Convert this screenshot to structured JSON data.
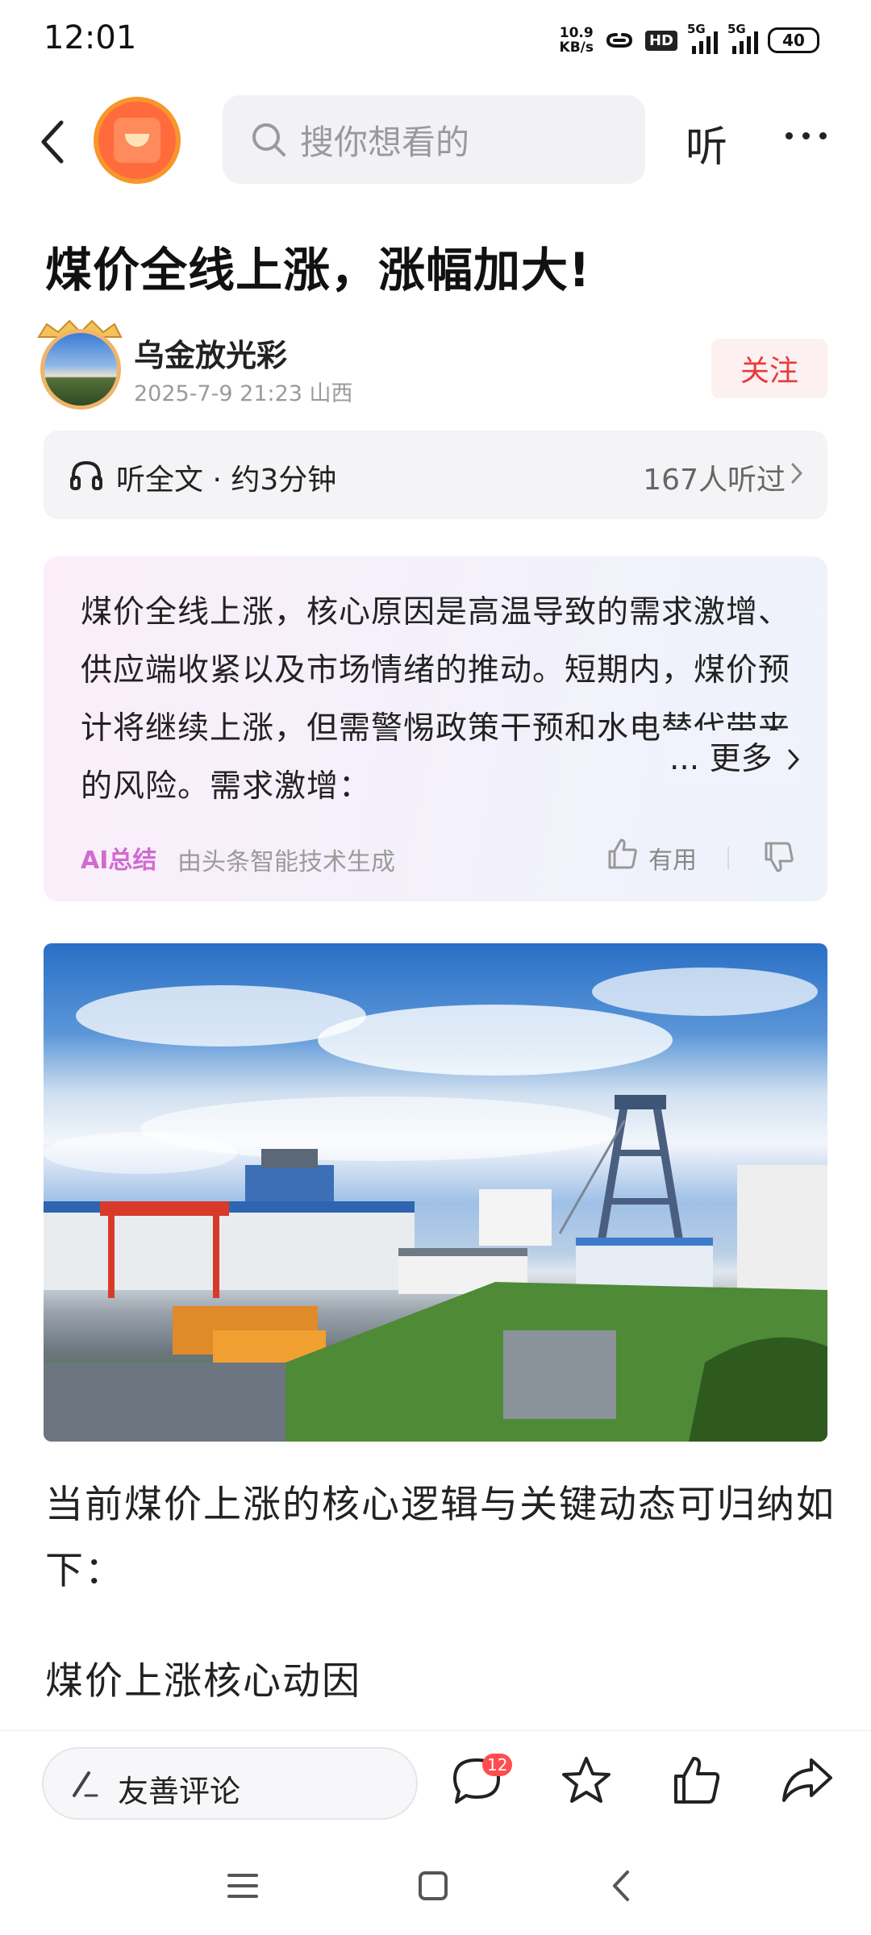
{
  "status_bar": {
    "time": "12:01",
    "net_speed_value": "10.9",
    "net_speed_unit": "KB/s",
    "hd_label": "HD",
    "network_1": "5G",
    "network_2": "5G",
    "battery": "40"
  },
  "nav": {
    "search_placeholder": "搜你想看的",
    "listen_label": "听"
  },
  "article": {
    "title": "煤价全线上涨，涨幅加大!",
    "author_name": "乌金放光彩",
    "author_meta": "2025-7-9  21:23  山西",
    "follow_label": "关注"
  },
  "listen_bar": {
    "label": "听全文 · 约3分钟",
    "count": "167人听过"
  },
  "ai_summary": {
    "text": "煤价全线上涨，核心原因是高温导致的需求激增、供应端收紧以及市场情绪的推动。短期内，煤价预计将继续上涨，但需警惕政策干预和水电替代带来的风险。需求激增：",
    "more_label": "... 更多",
    "badge": "AI总结",
    "source": "由头条智能技术生成",
    "useful_label": "有用"
  },
  "body": {
    "paragraph_1": "当前煤价上涨的核心逻辑与关键动态可归纳如下：",
    "heading_1": "煤价上涨核心动因"
  },
  "bottom_bar": {
    "comment_placeholder": "友善评论",
    "comment_count": "12"
  },
  "colors": {
    "accent_red": "#e83a3a",
    "ai_badge": "#d06bd0",
    "logo_orange": "#f7962a"
  }
}
